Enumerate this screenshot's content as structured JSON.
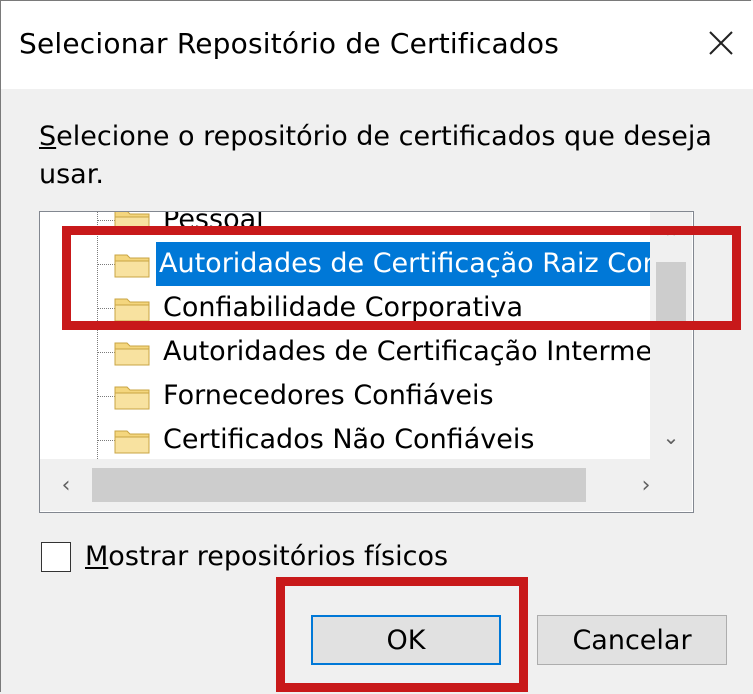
{
  "dialog": {
    "title": "Selecionar Repositório de Certificados",
    "instruction_first": "S",
    "instruction_rest": "elecione o repositório de certificados que deseja usar."
  },
  "tree": {
    "items": [
      {
        "label": "Pessoal",
        "selected": false
      },
      {
        "label": "Autoridades de Certificação Raiz Confiáv",
        "selected": true
      },
      {
        "label": "Confiabilidade Corporativa",
        "selected": false
      },
      {
        "label": "Autoridades de Certificação Intermediári",
        "selected": false
      },
      {
        "label": "Fornecedores Confiáveis",
        "selected": false
      },
      {
        "label": "Certificados Não Confiáveis",
        "selected": false
      }
    ]
  },
  "checkbox": {
    "label_first": "M",
    "label_rest": "ostrar repositórios físicos",
    "checked": false
  },
  "buttons": {
    "ok": "OK",
    "cancel": "Cancelar"
  },
  "colors": {
    "highlight": "#c8191a",
    "selection": "#0078d7"
  }
}
